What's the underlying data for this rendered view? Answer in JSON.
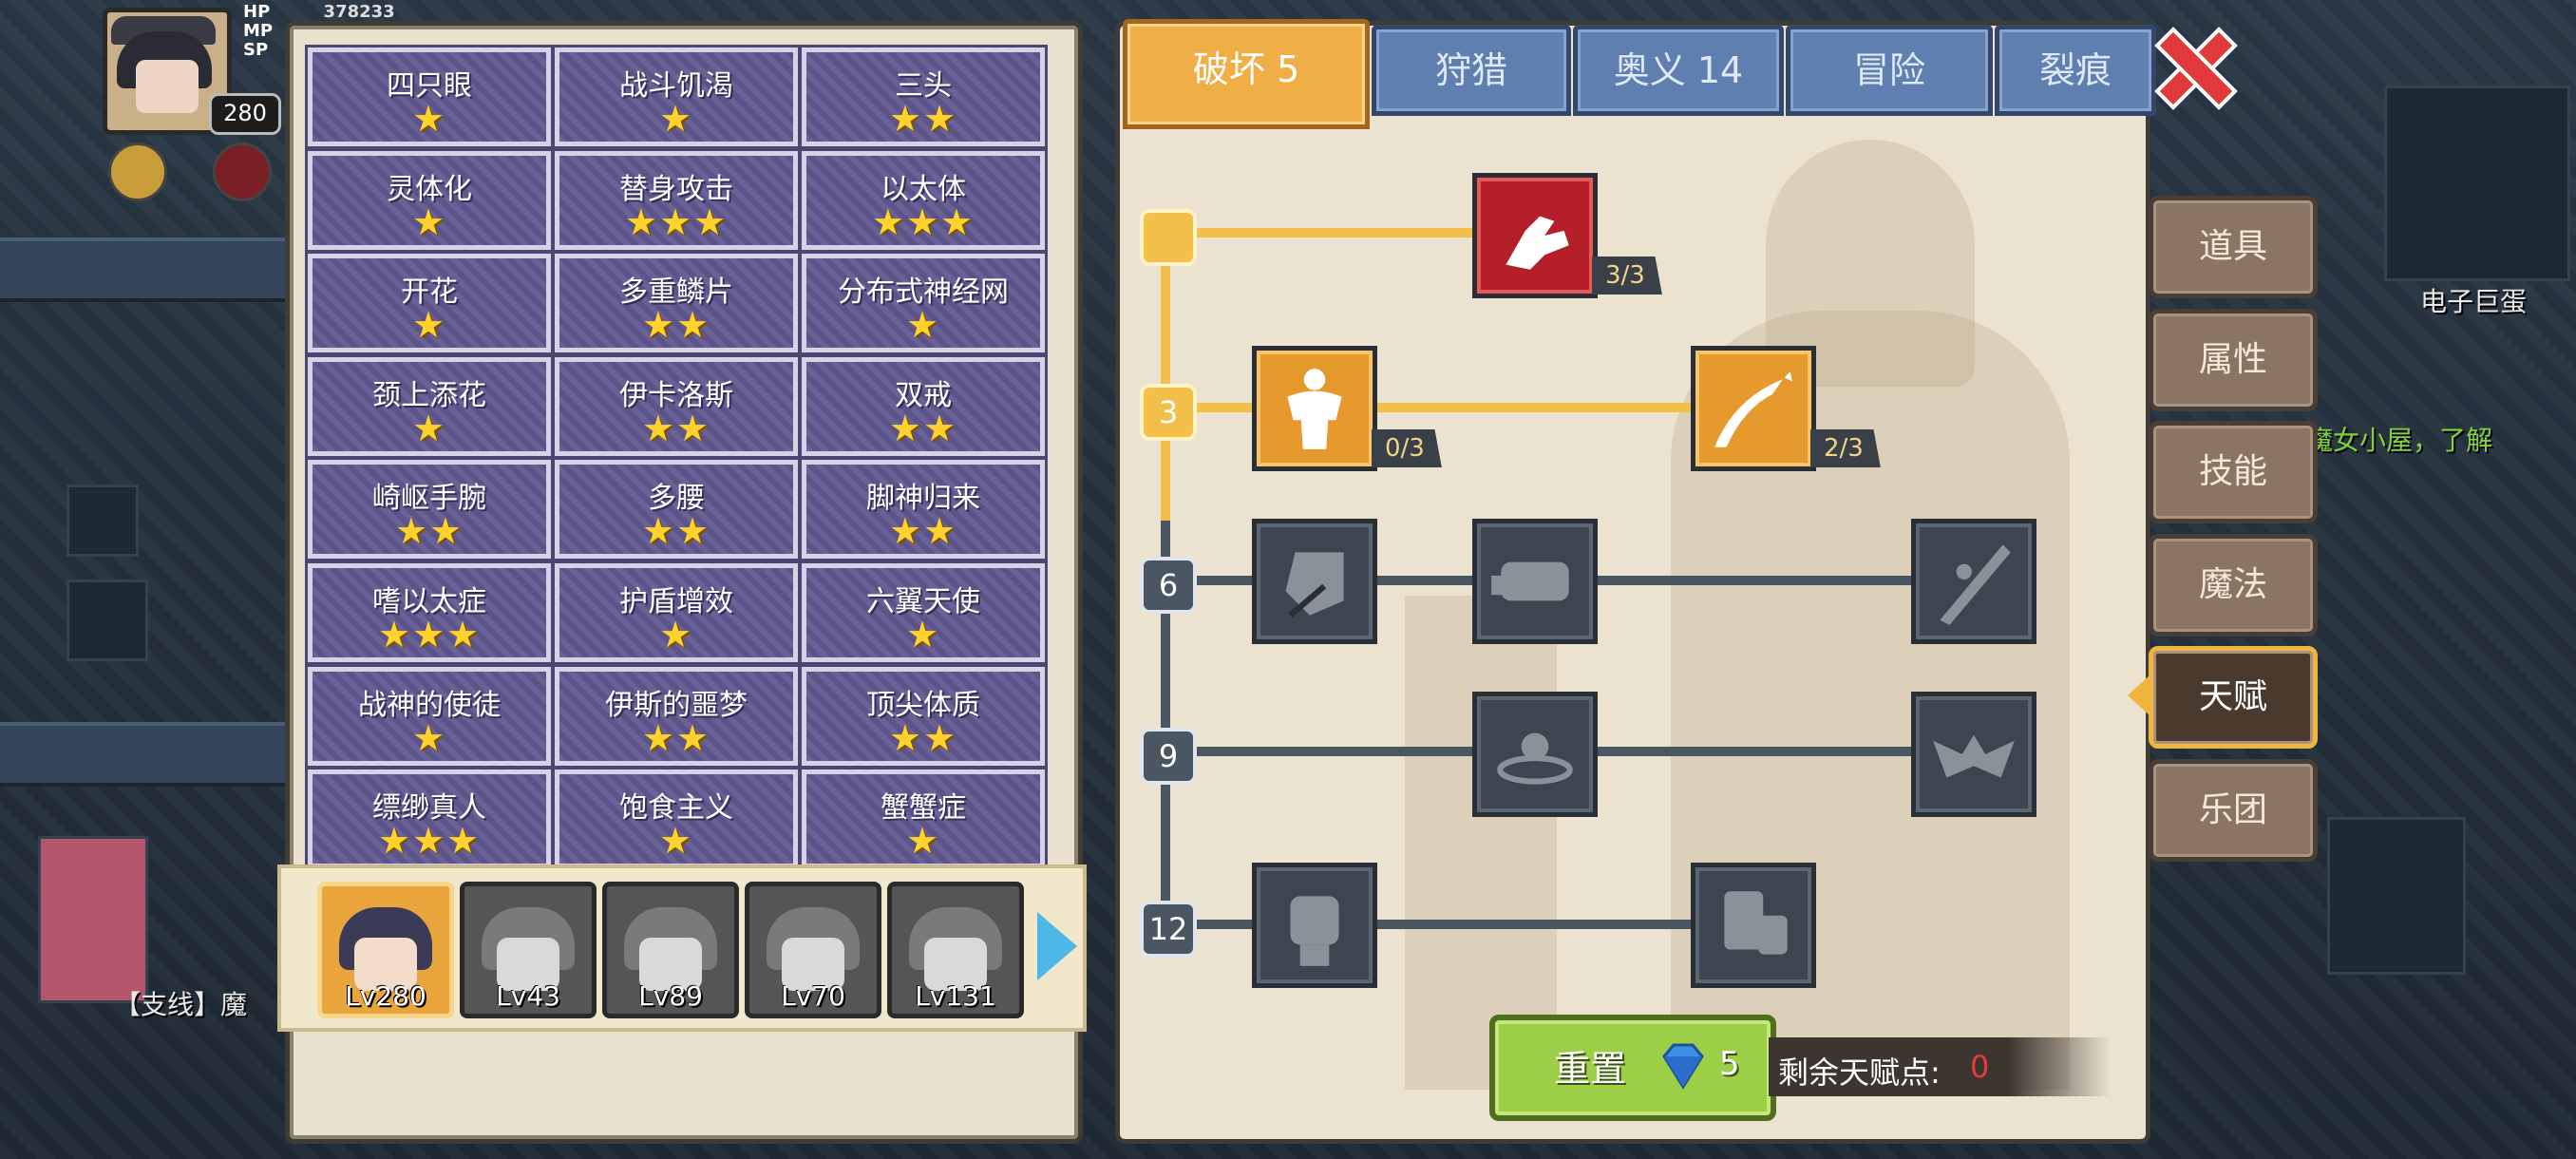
{
  "hud": {
    "level": "280",
    "hp_label": "HP",
    "hp_value": "378233",
    "mp_label": "MP",
    "sp_label": "SP"
  },
  "background": {
    "npc_label": "电子巨蛋",
    "quest_text": "【支线】魔",
    "hint_text": "魔女小屋，了解"
  },
  "traits": [
    {
      "name": "四只眼",
      "stars": "★"
    },
    {
      "name": "战斗饥渴",
      "stars": "★"
    },
    {
      "name": "三头",
      "stars": "★★"
    },
    {
      "name": "灵体化",
      "stars": "★"
    },
    {
      "name": "替身攻击",
      "stars": "★★★"
    },
    {
      "name": "以太体",
      "stars": "★★★"
    },
    {
      "name": "开花",
      "stars": "★"
    },
    {
      "name": "多重鳞片",
      "stars": "★★"
    },
    {
      "name": "分布式神经网",
      "stars": "★"
    },
    {
      "name": "颈上添花",
      "stars": "★"
    },
    {
      "name": "伊卡洛斯",
      "stars": "★★"
    },
    {
      "name": "双戒",
      "stars": "★★"
    },
    {
      "name": "崎岖手腕",
      "stars": "★★"
    },
    {
      "name": "多腰",
      "stars": "★★"
    },
    {
      "name": "脚神归来",
      "stars": "★★"
    },
    {
      "name": "嗜以太症",
      "stars": "★★★"
    },
    {
      "name": "护盾增效",
      "stars": "★"
    },
    {
      "name": "六翼天使",
      "stars": "★"
    },
    {
      "name": "战神的使徒",
      "stars": "★"
    },
    {
      "name": "伊斯的噩梦",
      "stars": "★★"
    },
    {
      "name": "顶尖体质",
      "stars": "★★"
    },
    {
      "name": "缥缈真人",
      "stars": "★★★"
    },
    {
      "name": "饱食主义",
      "stars": "★"
    },
    {
      "name": "蟹蟹症",
      "stars": "★"
    }
  ],
  "characters": [
    {
      "level": "Lv280"
    },
    {
      "level": "Lv43"
    },
    {
      "level": "Lv89"
    },
    {
      "level": "Lv70"
    },
    {
      "level": "Lv131"
    }
  ],
  "tabs": [
    {
      "label": "破坏 5"
    },
    {
      "label": "狩猎"
    },
    {
      "label": "奥义 14"
    },
    {
      "label": "冒险"
    },
    {
      "label": "裂痕"
    }
  ],
  "side_menu": [
    {
      "label": "道具"
    },
    {
      "label": "属性"
    },
    {
      "label": "技能"
    },
    {
      "label": "魔法"
    },
    {
      "label": "天赋"
    },
    {
      "label": "乐团"
    }
  ],
  "talent_tree": {
    "tiers": [
      "",
      "3",
      "6",
      "9",
      "12"
    ],
    "nodes": [
      {
        "icon": "arm-wrestle-icon",
        "count": "3/3"
      },
      {
        "icon": "muscle-body-icon",
        "count": "0/3"
      },
      {
        "icon": "arrow-strike-icon",
        "count": "2/3"
      },
      {
        "icon": "shield-break-icon",
        "count": ""
      },
      {
        "icon": "punch-icon",
        "count": ""
      },
      {
        "icon": "slash-icon",
        "count": ""
      },
      {
        "icon": "ripple-icon",
        "count": ""
      },
      {
        "icon": "bat-wing-icon",
        "count": ""
      },
      {
        "icon": "fist-icon",
        "count": ""
      },
      {
        "icon": "grip-icon",
        "count": ""
      }
    ]
  },
  "reset": {
    "label": "重置",
    "cost": "5",
    "remaining_label": "剩余天赋点:",
    "remaining_value": "0"
  },
  "colors": {
    "accent_gold": "#f2c04a",
    "tab_active": "#efae46",
    "tab_inactive": "#5f7fb1",
    "star": "#ffd22e",
    "reset_green": "#9cce47",
    "points_red": "#e43c3c"
  }
}
